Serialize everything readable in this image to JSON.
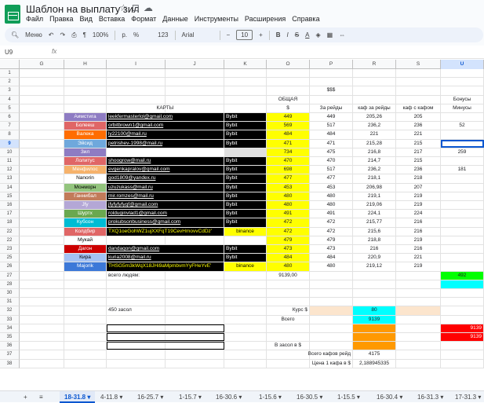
{
  "app": {
    "title": "Шаблон на выплату зил",
    "menu": [
      "Файл",
      "Правка",
      "Вид",
      "Вставка",
      "Формат",
      "Данные",
      "Инструменты",
      "Расширения",
      "Справка"
    ]
  },
  "toolbar": {
    "menu_label": "Меню",
    "zoom": "100%",
    "currency": "р.",
    "percent": "%",
    ".0": ".0",
    ".00": ".00",
    "num123": "123",
    "font": "Arial",
    "font_size": "10"
  },
  "formula": {
    "cell_ref": "U9",
    "fx": "fx"
  },
  "columns": [
    "G",
    "H",
    "I",
    "J",
    "K",
    "O",
    "P",
    "R",
    "S",
    "U"
  ],
  "rows": [
    {
      "n": "1",
      "cells": {}
    },
    {
      "n": "2",
      "cells": {}
    },
    {
      "n": "3",
      "cells": {
        "P": "$$$"
      }
    },
    {
      "n": "4",
      "cells": {
        "O": "ОБЩАЯ",
        "U": "Бонусы"
      }
    },
    {
      "n": "5",
      "cells": {
        "I": "КАРТЫ",
        "O": "$",
        "P": "За рейды",
        "R": "каф за рейды",
        "S": "каф с кафом",
        "U": "Минусы"
      }
    },
    {
      "n": "6",
      "cells": {
        "H": "Аимстига",
        "I": "leekfermasterlol@gmail.com",
        "K": "Bybit",
        "O": "449",
        "P": "449",
        "R": "205,26",
        "S": "205"
      }
    },
    {
      "n": "7",
      "cells": {
        "H": "Болееш",
        "I": "orbitbrown1@gmail.com",
        "K": "Bybit",
        "O": "569",
        "P": "517",
        "R": "236,2",
        "S": "236",
        "U": "52"
      }
    },
    {
      "n": "8",
      "cells": {
        "H": "Валека",
        "I": "ly22100@mail.ru",
        "K": "Bybit",
        "O": "484",
        "P": "484",
        "R": "221",
        "S": "221"
      }
    },
    {
      "n": "9",
      "cells": {
        "H": "Эйсид",
        "I": "petrishev-1998@mail.ru",
        "K": "Bybit",
        "O": "471",
        "P": "471",
        "R": "215,28",
        "S": "215"
      }
    },
    {
      "n": "10",
      "cells": {
        "H": "Зил",
        "O": "734",
        "P": "475",
        "R": "216,8",
        "S": "217",
        "U": "259"
      }
    },
    {
      "n": "11",
      "cells": {
        "H": "Лолитус",
        "I": "shoogrow@mail.ru",
        "K": "Bybit",
        "O": "470",
        "P": "470",
        "R": "214,7",
        "S": "215"
      }
    },
    {
      "n": "12",
      "cells": {
        "H": "Менфилос",
        "I": "evgenkapralov@gmail.com",
        "K": "Bybit",
        "O": "698",
        "P": "517",
        "R": "236,2",
        "S": "236",
        "U": "181"
      }
    },
    {
      "n": "13",
      "cells": {
        "H": "Nanorin",
        "I": "god1809@yandex.ru",
        "K": "Bybit",
        "O": "477",
        "P": "477",
        "R": "218,1",
        "S": "218"
      }
    },
    {
      "n": "14",
      "cells": {
        "H": "Монморн",
        "I": "uzuzukass@mail.ru",
        "K": "Bybit",
        "O": "453",
        "P": "453",
        "R": "206,98",
        "S": "207"
      }
    },
    {
      "n": "15",
      "cells": {
        "H": "Ганнибал",
        "I": "mir.romzes@mail.ru",
        "K": "Bybit",
        "O": "480",
        "P": "480",
        "R": "219,1",
        "S": "219"
      }
    },
    {
      "n": "16",
      "cells": {
        "H": "Jfy",
        "I": "jfyfyfyfygf@gmail.com",
        "K": "Bybit",
        "O": "480",
        "P": "480",
        "R": "219,06",
        "S": "219"
      }
    },
    {
      "n": "17",
      "cells": {
        "H": "Шуртх",
        "I": "rolduginvlad1@gmail.com",
        "K": "Bybit",
        "O": "491",
        "P": "491",
        "R": "224,1",
        "S": "224"
      }
    },
    {
      "n": "18",
      "cells": {
        "H": "Кубсон",
        "I": "prokubsonbusiness@gmail.com",
        "K": "Bybit",
        "O": "472",
        "P": "472",
        "R": "215,77",
        "S": "216"
      }
    },
    {
      "n": "22",
      "cells": {
        "H": "Колдбир",
        "I": "TXQ1oeGohWZ1ujXXFqT19CevHmovvCdDz'",
        "K": "binance",
        "O": "472",
        "P": "472",
        "R": "215,6",
        "S": "216"
      }
    },
    {
      "n": "22",
      "cells": {
        "H": "Мукай",
        "O": "479",
        "P": "479",
        "R": "218,8",
        "S": "219"
      }
    },
    {
      "n": "23",
      "cells": {
        "H": "Дагон",
        "I": "dandaqon@gmail.com",
        "K": "Bybit",
        "O": "473",
        "P": "473",
        "R": "216",
        "S": "216"
      }
    },
    {
      "n": "25",
      "cells": {
        "H": "Кира",
        "I": "kuria2008@mail.ru",
        "K": "Bybit",
        "O": "484",
        "P": "484",
        "R": "220,9",
        "S": "221"
      }
    },
    {
      "n": "26",
      "cells": {
        "H": "Majorik",
        "I": "THSG5m3kWqX18JHi9aMpmbvmYyFHeYvE'",
        "K": "binance",
        "O": "480",
        "P": "480",
        "R": "219,12",
        "S": "219"
      }
    },
    {
      "n": "27",
      "cells": {
        "I": "всего людям:",
        "O": "9139,00",
        "U": "492"
      }
    },
    {
      "n": "28",
      "cells": {}
    },
    {
      "n": "30",
      "cells": {}
    },
    {
      "n": "31",
      "cells": {}
    },
    {
      "n": "32",
      "cells": {
        "I": "450 засол",
        "O": "Курс $",
        "R": "80"
      }
    },
    {
      "n": "33",
      "cells": {
        "O": "Всего",
        "R": "9139"
      }
    },
    {
      "n": "34",
      "cells": {
        "U": "9139"
      }
    },
    {
      "n": "35",
      "cells": {
        "U": "9139"
      }
    },
    {
      "n": "36",
      "cells": {
        "O": "В засол в $"
      }
    },
    {
      "n": "37",
      "cells": {
        "O": "Всего кафов  рейд",
        "R": "4175"
      }
    },
    {
      "n": "38",
      "cells": {
        "O": "Цена 1 кафа в $",
        "R": "2,188945335"
      }
    }
  ],
  "sheet_tabs": [
    "18-31.8",
    "4-11.8",
    "16-25.7",
    "1-15.7",
    "16-30.6",
    "1-15.6",
    "16-30.5",
    "1-15.5",
    "16-30.4",
    "16-31.3",
    "17-31.3"
  ],
  "active_tab": "18-31.8",
  "colors": {
    "accent": "#0b57d0",
    "yellow": "#ffff00",
    "black": "#000000",
    "cyan": "#00ffff",
    "orange": "#ff9900",
    "red": "#ff0000",
    "green": "#00ff00"
  }
}
